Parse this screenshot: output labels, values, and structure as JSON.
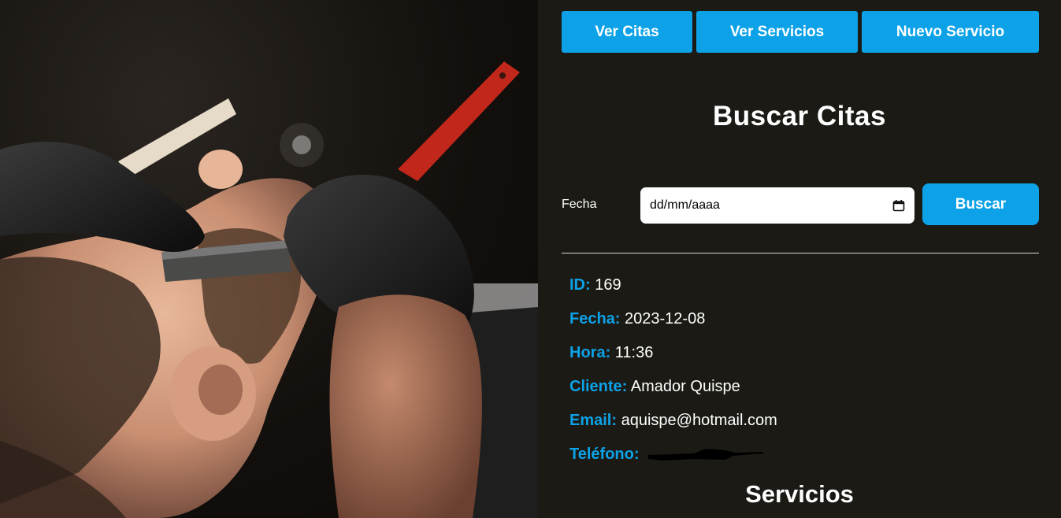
{
  "nav": {
    "ver_citas": "Ver Citas",
    "ver_servicios": "Ver Servicios",
    "nuevo_servicio": "Nuevo Servicio"
  },
  "main": {
    "title": "Buscar Citas",
    "search": {
      "label": "Fecha",
      "date_placeholder": "dd/mm/aaaa",
      "button": "Buscar"
    },
    "cita": {
      "id_label": "ID:",
      "id": "169",
      "fecha_label": "Fecha:",
      "fecha": "2023-12-08",
      "hora_label": "Hora:",
      "hora": "11:36",
      "cliente_label": "Cliente:",
      "cliente": "Amador Quispe",
      "email_label": "Email:",
      "email": "aquispe@hotmail.com",
      "telefono_label": "Teléfono:"
    },
    "servicios_title": "Servicios"
  },
  "colors": {
    "accent": "#0da2e7",
    "background": "#1b1a14",
    "text": "#ffffff"
  },
  "icons": {
    "date_picker": "calendar-icon"
  }
}
